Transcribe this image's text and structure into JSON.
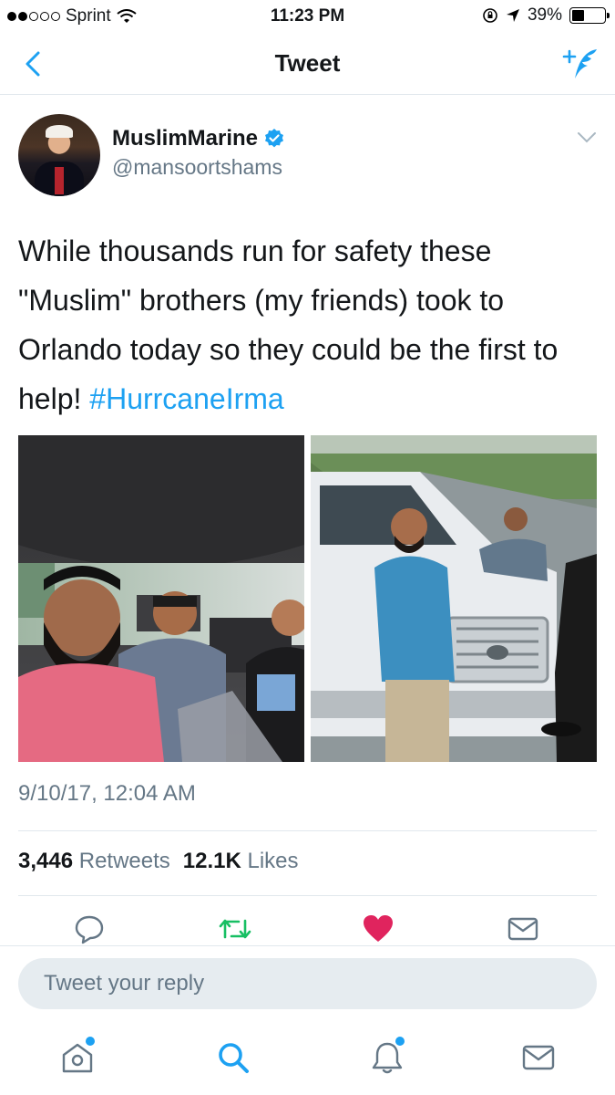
{
  "status_bar": {
    "carrier": "Sprint",
    "time": "11:23 PM",
    "battery": "39%",
    "battery_level": 0.39
  },
  "nav": {
    "title": "Tweet"
  },
  "tweet": {
    "author_name": "MuslimMarine",
    "author_handle": "@mansoortshams",
    "text_plain": "While thousands run for safety these \"Muslim\" brothers (my friends) took to Orlando today so they could be the first to help! ",
    "hashtag": "#HurrcaneIrma",
    "timestamp": "9/10/17, 12:04 AM",
    "retweets_count": "3,446",
    "retweets_label": "Retweets",
    "likes_count": "12.1K",
    "likes_label": "Likes"
  },
  "actions": {
    "reply_icon": "reply-icon",
    "retweet_icon": "retweet-icon",
    "like_icon": "heart-icon",
    "dm_icon": "envelope-icon",
    "retweet_color": "#17bf63",
    "like_color": "#e0245e"
  },
  "reply": {
    "placeholder": "Tweet your reply"
  },
  "colors": {
    "accent": "#1da1f2",
    "secondary_text": "#657786"
  }
}
